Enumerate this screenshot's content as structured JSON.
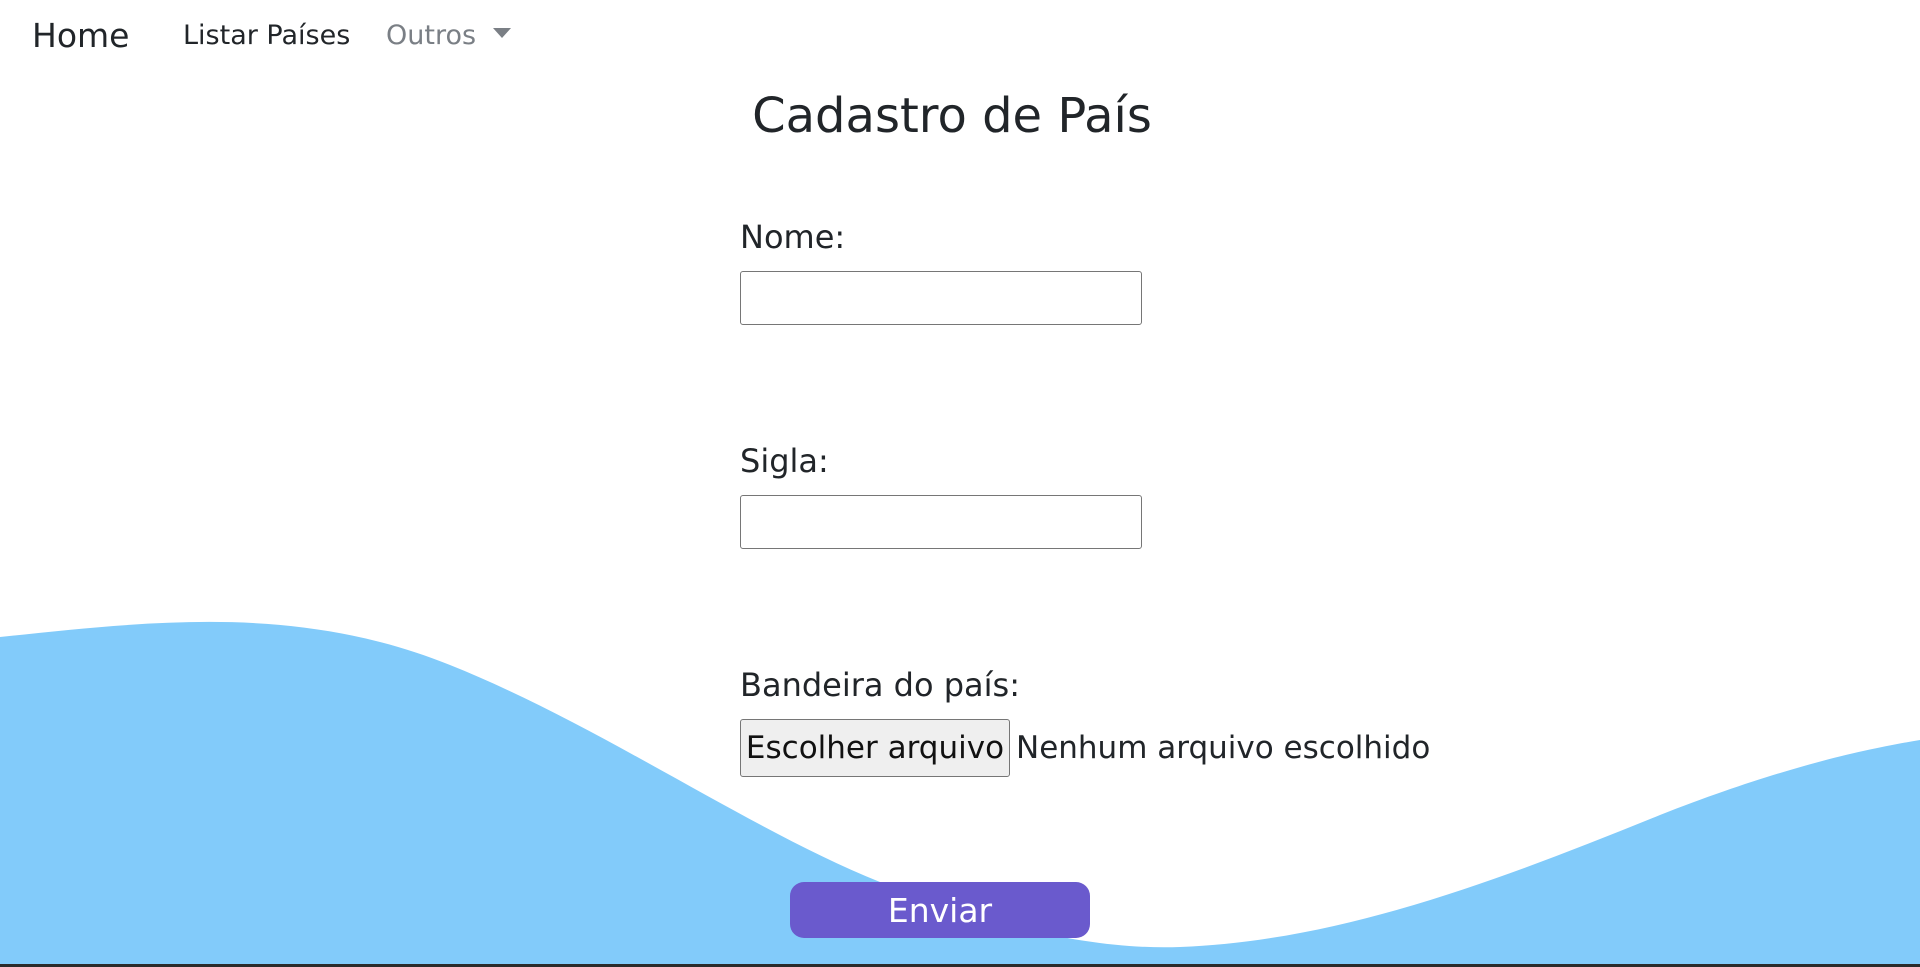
{
  "navbar": {
    "brand": "Home",
    "links": [
      {
        "label": "Listar Países"
      },
      {
        "label": "Outros"
      }
    ]
  },
  "page": {
    "title": "Cadastro de País"
  },
  "form": {
    "nome": {
      "label": "Nome:",
      "value": ""
    },
    "sigla": {
      "label": "Sigla:",
      "value": ""
    },
    "bandeira": {
      "label": "Bandeira do país:",
      "button_label": "Escolher arquivo",
      "status": "Nenhum arquivo escolhido"
    },
    "submit_label": "Enviar"
  },
  "colors": {
    "wave": "#82cbfa",
    "submit": "#6a5acd",
    "nav_muted": "#7a7f85"
  },
  "icons": {
    "dropdown": "caret-down-icon"
  }
}
